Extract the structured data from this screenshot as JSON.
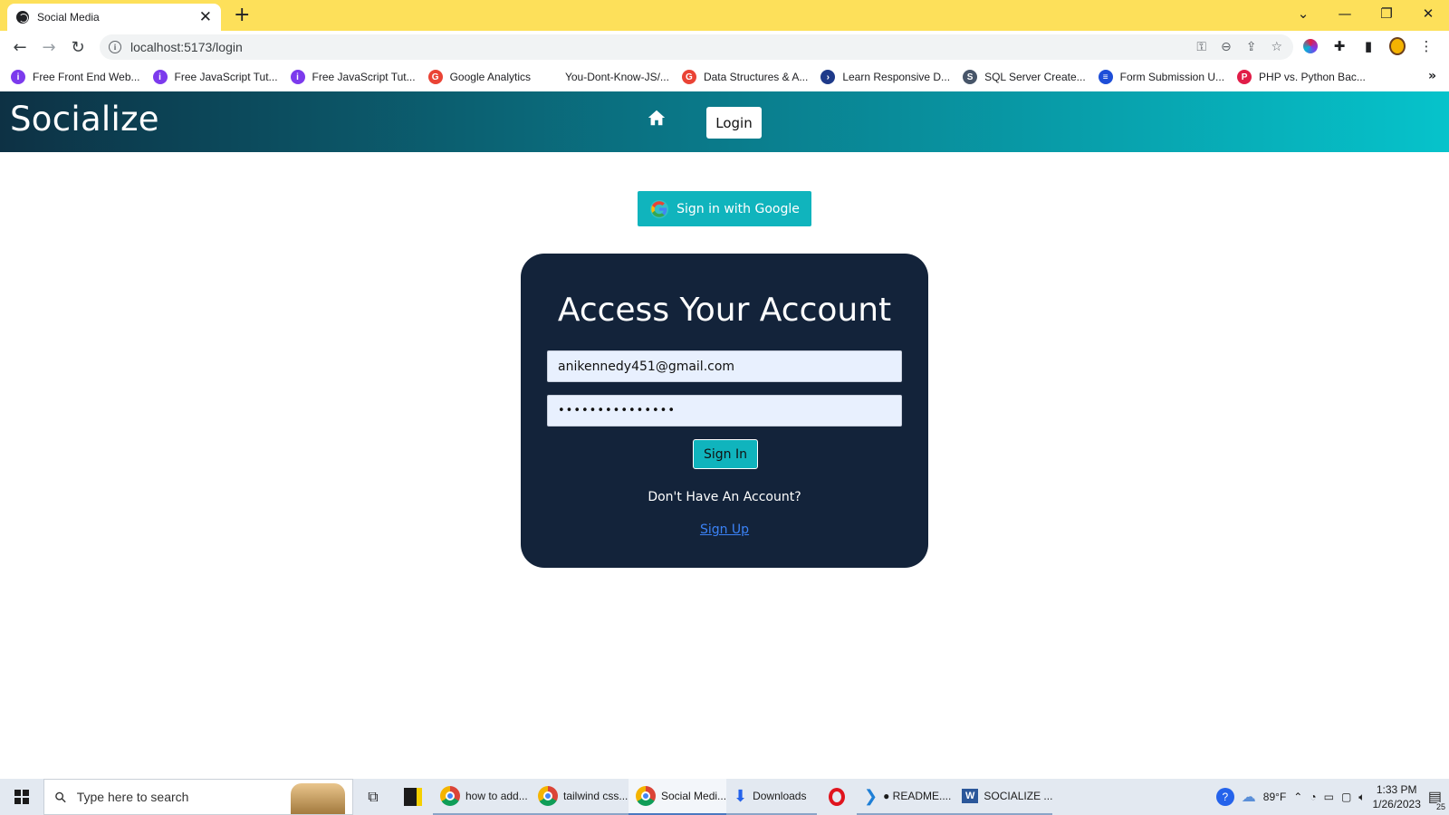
{
  "browser": {
    "tab_title": "Social Media",
    "url": "localhost:5173/login",
    "bookmarks": [
      {
        "label": "Free Front End Web...",
        "color": "#7c3aed",
        "glyph": "i"
      },
      {
        "label": "Free JavaScript Tut...",
        "color": "#7c3aed",
        "glyph": "i"
      },
      {
        "label": "Free JavaScript Tut...",
        "color": "#7c3aed",
        "glyph": "i"
      },
      {
        "label": "Google Analytics",
        "color": "#ea4335",
        "glyph": "G"
      },
      {
        "label": "You-Dont-Know-JS/...",
        "color": "#ffffff",
        "glyph": ""
      },
      {
        "label": "Data Structures & A...",
        "color": "#ea4335",
        "glyph": "G"
      },
      {
        "label": "Learn Responsive D...",
        "color": "#1e3a8a",
        "glyph": "›"
      },
      {
        "label": "SQL Server Create...",
        "color": "#475569",
        "glyph": "S"
      },
      {
        "label": "Form Submission U...",
        "color": "#1d4ed8",
        "glyph": "≡"
      },
      {
        "label": "PHP vs. Python Bac...",
        "color": "#e11d48",
        "glyph": "P"
      }
    ]
  },
  "app": {
    "brand": "Socialize",
    "nav_login": "Login",
    "google_button": "Sign in with Google",
    "card": {
      "title": "Access Your Account",
      "email_value": "anikennedy451@gmail.com",
      "password_mask": "•••••••••••••••",
      "signin_label": "Sign In",
      "no_account_text": "Don't Have An Account?",
      "signup_link": "Sign Up"
    },
    "colors": {
      "header_start": "#0d3144",
      "header_end": "#06c3cb",
      "accent": "#10b4bd",
      "card_bg": "#13233a"
    }
  },
  "taskbar": {
    "search_placeholder": "Type here to search",
    "apps": [
      {
        "label": "how to add...",
        "icon": "chrome-icon"
      },
      {
        "label": "tailwind css...",
        "icon": "chrome-icon"
      },
      {
        "label": "Social Medi...",
        "icon": "chrome-icon",
        "active": true
      },
      {
        "label": "Downloads",
        "icon": "download-folder-icon"
      },
      {
        "label": "● README....",
        "icon": "vscode-icon"
      },
      {
        "label": "SOCIALIZE ...",
        "icon": "word-icon"
      }
    ],
    "weather": "89°F",
    "time": "1:33 PM",
    "date": "1/26/2023",
    "notifications": "25"
  }
}
